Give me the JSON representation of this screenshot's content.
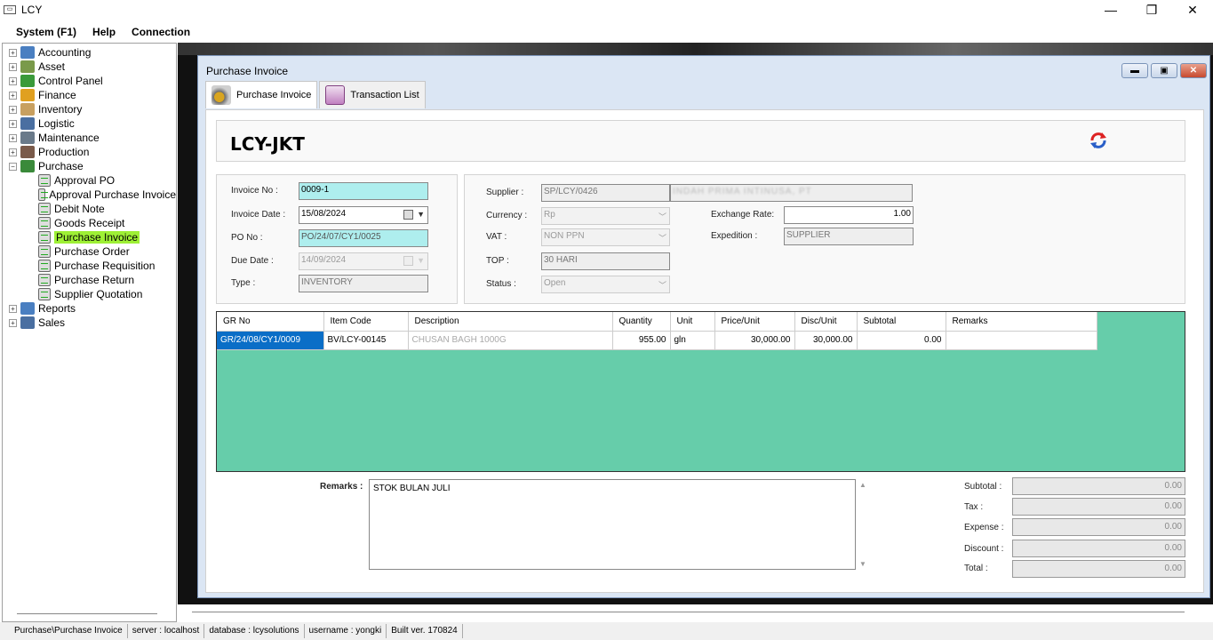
{
  "window": {
    "title": "LCY",
    "minimize": "—",
    "maximize": "❐",
    "close": "✕"
  },
  "menu": [
    "System (F1)",
    "Help",
    "Connection"
  ],
  "sidebar": {
    "items": [
      {
        "label": "Accounting",
        "expander": "+",
        "icon_color": "#4a7fc1"
      },
      {
        "label": "Asset",
        "expander": "+",
        "icon_color": "#7a9a4a"
      },
      {
        "label": "Control Panel",
        "expander": "+",
        "icon_color": "#3a9a3a"
      },
      {
        "label": "Finance",
        "expander": "+",
        "icon_color": "#e0a020"
      },
      {
        "label": "Inventory",
        "expander": "+",
        "icon_color": "#c8a060"
      },
      {
        "label": "Logistic",
        "expander": "+",
        "icon_color": "#4a6fa1"
      },
      {
        "label": "Maintenance",
        "expander": "+",
        "icon_color": "#6a7a8a"
      },
      {
        "label": "Production",
        "expander": "+",
        "icon_color": "#7a5a4a"
      },
      {
        "label": "Purchase",
        "expander": "−",
        "icon_color": "#3a8a3a"
      }
    ],
    "purchase_children": [
      {
        "label": "Approval PO"
      },
      {
        "label": "Approval Purchase Invoice"
      },
      {
        "label": "Debit Note"
      },
      {
        "label": "Goods Receipt"
      },
      {
        "label": "Purchase Invoice",
        "selected": true
      },
      {
        "label": "Purchase Order"
      },
      {
        "label": "Purchase Requisition"
      },
      {
        "label": "Purchase Return"
      },
      {
        "label": "Supplier Quotation"
      }
    ],
    "bottom_items": [
      {
        "label": "Reports",
        "expander": "+",
        "icon_color": "#4a7fc1"
      },
      {
        "label": "Sales",
        "expander": "+",
        "icon_color": "#4a6fa1"
      }
    ]
  },
  "child_window": {
    "title": "Purchase Invoice",
    "tabs": [
      {
        "label": "Purchase Invoice",
        "active": true,
        "icon": "invoice-icon"
      },
      {
        "label": "Transaction List",
        "active": false,
        "icon": "transaction-list-icon"
      }
    ]
  },
  "header": {
    "company": "LCY-JKT"
  },
  "form": {
    "invoice_no_label": "Invoice No :",
    "invoice_no": "0009-1",
    "invoice_date_label": "Invoice Date :",
    "invoice_date": "15/08/2024",
    "po_no_label": "PO No :",
    "po_no": "PO/24/07/CY1/0025",
    "due_date_label": "Due Date :",
    "due_date": "14/09/2024",
    "type_label": "Type :",
    "type": "INVENTORY",
    "supplier_label": "Supplier :",
    "supplier_code": "SP/LCY/0426",
    "supplier_name": "INDAH PRIMA INTINUSA, PT",
    "currency_label": "Currency :",
    "currency": "Rp",
    "vat_label": "VAT :",
    "vat": "NON PPN",
    "top_label": "TOP :",
    "top": "30 HARI",
    "status_label": "Status :",
    "status": "Open",
    "exchange_rate_label": "Exchange Rate:",
    "exchange_rate": "1.00",
    "expedition_label": "Expedition :",
    "expedition": "SUPPLIER"
  },
  "grid": {
    "columns": [
      "GR No",
      "Item Code",
      "Description",
      "Quantity",
      "Unit",
      "Price/Unit",
      "Disc/Unit",
      "Subtotal",
      "Remarks"
    ],
    "rows": [
      [
        "GR/24/08/CY1/0009",
        "BV/LCY-00145",
        "CHUSAN BAGH 1000G",
        "955.00",
        "gln",
        "30,000.00",
        "30,000.00",
        "0.00",
        ""
      ]
    ]
  },
  "bottom": {
    "remarks_label": "Remarks :",
    "remarks": "STOK BULAN JULI",
    "subtotal_label": "Subtotal :",
    "subtotal": "0.00",
    "tax_label": "Tax :",
    "tax": "0.00",
    "expense_label": "Expense :",
    "expense": "0.00",
    "discount_label": "Discount :",
    "discount": "0.00",
    "total_label": "Total :",
    "total": "0.00"
  },
  "statusbar": [
    "Purchase\\Purchase Invoice",
    "server : localhost",
    "database : lcysolutions",
    "username : yongki",
    "Built ver. 170824"
  ],
  "colors": {
    "grid_bg": "#66cdaa",
    "selected_tree": "#9ef035",
    "selected_cell": "#0a6ec7",
    "teal_field": "#aeeeee"
  }
}
